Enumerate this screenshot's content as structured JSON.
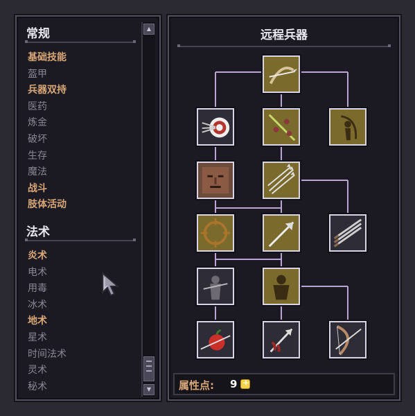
{
  "left": {
    "general_title": "常规",
    "general_items": [
      {
        "label": "基础技能",
        "highlight": true
      },
      {
        "label": "盔甲",
        "highlight": false
      },
      {
        "label": "兵器双持",
        "highlight": true
      },
      {
        "label": "医药",
        "highlight": false
      },
      {
        "label": "炼金",
        "highlight": false
      },
      {
        "label": "破坏",
        "highlight": false
      },
      {
        "label": "生存",
        "highlight": false
      },
      {
        "label": "魔法",
        "highlight": false
      },
      {
        "label": "战斗",
        "highlight": true
      },
      {
        "label": "肢体活动",
        "highlight": true
      }
    ],
    "magic_title": "法术",
    "magic_items": [
      {
        "label": "炎术",
        "highlight": true
      },
      {
        "label": "电术",
        "highlight": false
      },
      {
        "label": "用毒",
        "highlight": false
      },
      {
        "label": "冰术",
        "highlight": false
      },
      {
        "label": "地术",
        "highlight": true
      },
      {
        "label": "星术",
        "highlight": false
      },
      {
        "label": "时间法术",
        "highlight": false
      },
      {
        "label": "灵术",
        "highlight": false
      },
      {
        "label": "秘术",
        "highlight": false
      }
    ]
  },
  "tree": {
    "title": "远程兵器",
    "skills": [
      {
        "icon": "bow-crossbow-icon",
        "bg": "olive"
      },
      {
        "icon": "archery-target-icon",
        "bg": "dark"
      },
      {
        "icon": "arrow-volley-icon",
        "bg": "olive"
      },
      {
        "icon": "archer-silhouette-icon",
        "bg": "olive"
      },
      {
        "icon": "stern-face-icon",
        "bg": "brown"
      },
      {
        "icon": "triple-arrows-icon",
        "bg": "olive"
      },
      {
        "icon": "crosshair-target-icon",
        "bg": "olive"
      },
      {
        "icon": "piercing-arrow-icon",
        "bg": "olive"
      },
      {
        "icon": "arrow-bundle-icon",
        "bg": "dark"
      },
      {
        "icon": "shadow-archer-icon",
        "bg": "dark"
      },
      {
        "icon": "glowing-figure-icon",
        "bg": "olive"
      },
      {
        "icon": "pierced-apple-icon",
        "bg": "dark"
      },
      {
        "icon": "bloody-arrow-icon",
        "bg": "dark"
      },
      {
        "icon": "long-bow-icon",
        "bg": "dark"
      }
    ]
  },
  "attributes": {
    "label": "属性点:",
    "value": "9",
    "icon": "plus-coin-icon"
  },
  "colors": {
    "highlight": "#d9a677",
    "dim": "#8a8794",
    "connector": "#b9a6d6",
    "olive": "#7a6a2c",
    "dark": "#2e2c36",
    "brown": "#6b4b3b"
  }
}
